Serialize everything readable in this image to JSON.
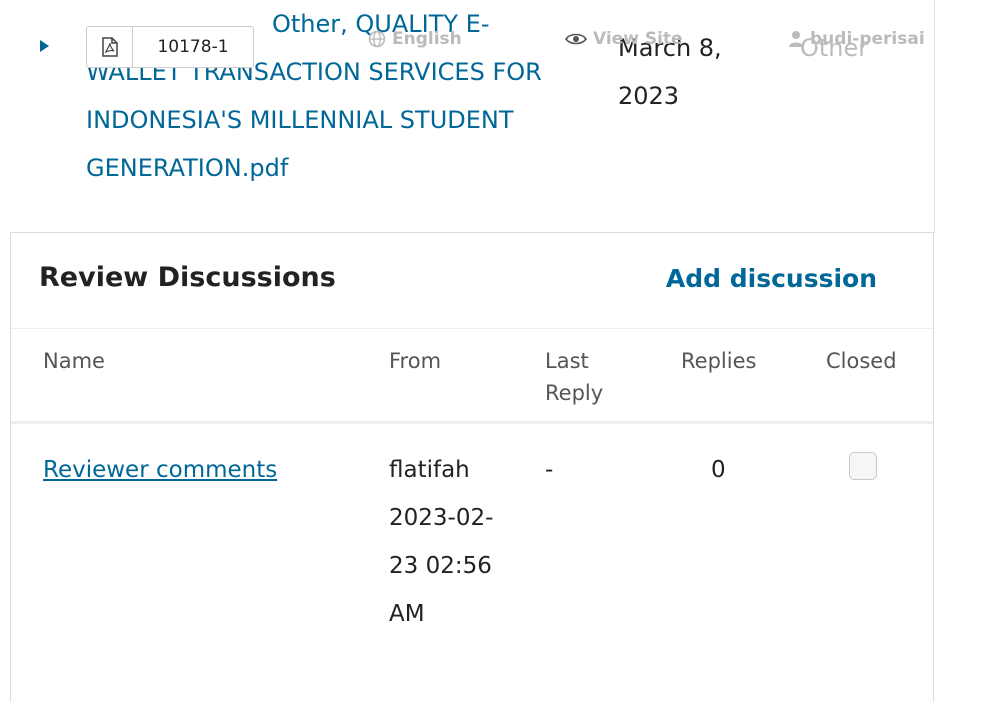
{
  "header": {
    "language_label": "English",
    "view_site_label": "View Site",
    "username": "budi-perisai"
  },
  "file": {
    "id": "10178-1",
    "name": "Other, QUALITY E-WALLET TRANSACTION SERVICES FOR INDONESIA'S MILLENNIAL STUDENT GENERATION.pdf",
    "date": "March 8, 2023",
    "type": "Other"
  },
  "discussions": {
    "title": "Review Discussions",
    "add_label": "Add discussion",
    "columns": [
      "Name",
      "From",
      "Last Reply",
      "Replies",
      "Closed"
    ],
    "rows": [
      {
        "name": "Reviewer comments",
        "from": "flatifah 2023-02-23 02:56 AM",
        "last_reply": "-",
        "replies": "0",
        "closed": false
      }
    ]
  },
  "colors": {
    "link": "#006798",
    "muted": "#bbbbbb",
    "border": "#dddddd"
  }
}
